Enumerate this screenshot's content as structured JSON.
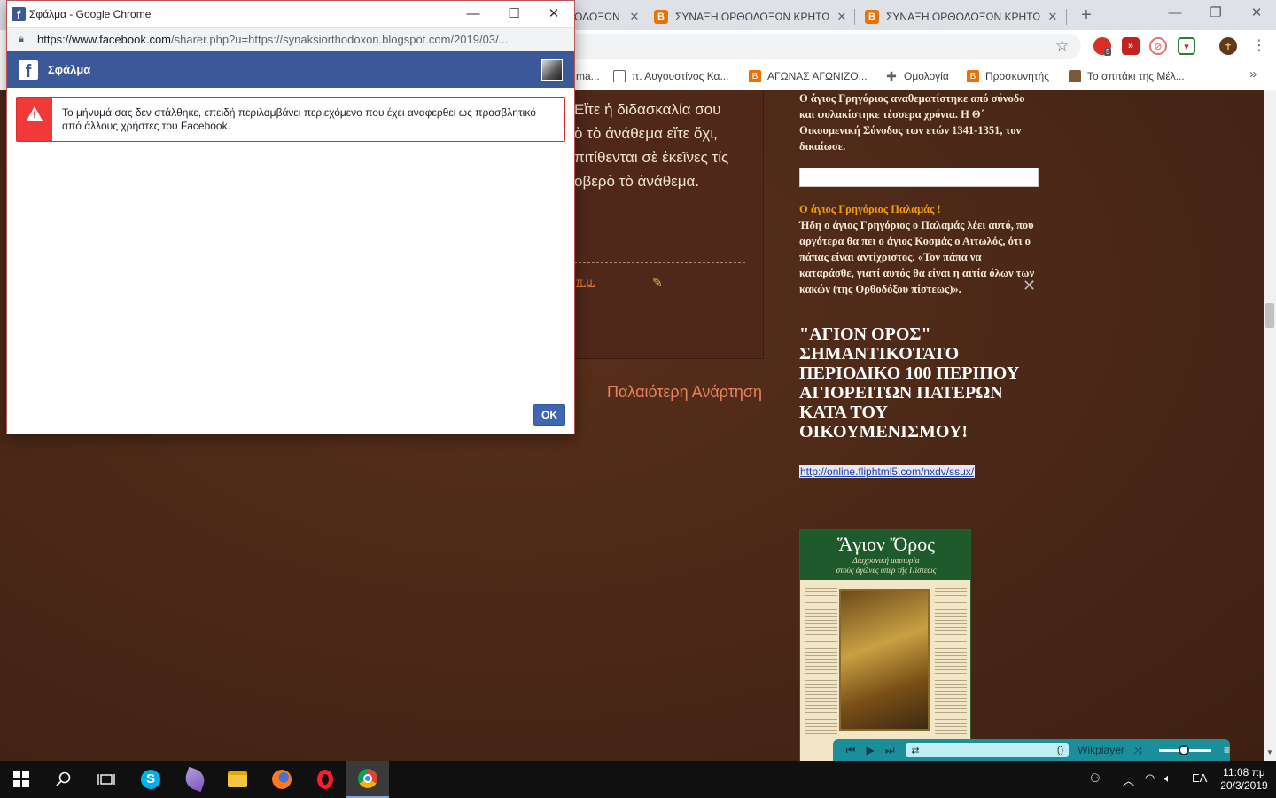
{
  "bg_window": {
    "tabs": [
      {
        "label": "ΟΔΟΞΩΝ"
      },
      {
        "label": "ΣΥΝΑΞΗ ΟΡΘΟΔΟΞΩΝ ΚΡΗΤΩΝ"
      },
      {
        "label": "ΣΥΝΑΞΗ ΟΡΘΟΔΟΞΩΝ ΚΡΗΤΩΝ"
      }
    ],
    "new_tab": "+",
    "bookmarks": [
      {
        "label": "ma..."
      },
      {
        "label": "π. Αυγουστίνος Κα..."
      },
      {
        "label": "ΑΓΩΝΑΣ ΑΓΩΝΙΖΟ..."
      },
      {
        "label": "Ομολογία"
      },
      {
        "label": "Προσκυνητής"
      },
      {
        "label": "Το σπιτάκι της Μέλ..."
      }
    ],
    "extensions_badge": "5"
  },
  "page": {
    "post_lines": [
      "Εἴτε ἡ διδασκαλία σου",
      "ὸ τὸ ἀνάθεμα εἴτε ὄχι,",
      "πιτίθενται σὲ ἐκεῖνες τίς",
      "οβερὸ τὸ ἀνάθεμα."
    ],
    "post_link_fragment": "π.μ.",
    "older_post": "Παλαιότερη Ανάρτηση",
    "sidebar_para1": "Ο άγιος Γρηγόριος αναθεματίστηκε από σύνοδο και φυλακίστηκε τέσσερα χρόνια.   Η Θ΄ Οικουμενική Σύνοδος των ετών 1341-1351, τον δικαίωσε.",
    "sidebar_heading2": "Ο άγιος Γρηγόριος Παλαμάς !",
    "sidebar_para2": "Ήδη ο άγιος Γρηγόριος ο Παλαμάς λέει αυτό, που αργότερα θα πει ο άγιος Κοσμάς ο Αιτωλός, ότι ο πάπας είναι αντίχριστος. «Τον πάπα να καταράσθε, γιατί αυτός θα είναι η αιτία όλων των κακών (της Ορθοδόξου πίστεως)».",
    "sidebar_big_heading": "\"ΑΓΙΟΝ ΟΡΟΣ\" ΣΗΜΑΝΤΙΚΟΤΑΤΟ ΠΕΡΙΟΔΙΚΟ 100 ΠΕΡΙΠΟΥ ΑΓΙΟΡΕΙΤΩΝ ΠΑΤΕΡΩΝ ΚΑΤΑ ΤΟΥ ΟΙΚΟΥΜΕΝΙΣΜΟΥ!",
    "sidebar_link": "http://online.fliphtml5.com/nxdv/ssux/",
    "book_title": "Ἅγιον Ὄρος",
    "book_subtitle_1": "Διαχρονική μαρτυρία",
    "book_subtitle_2": "στοὺς ἀγῶνες ὑπὲρ τῆς Πίστεως"
  },
  "wikplayer": {
    "name": "Wikplayer",
    "track_indicator": "()"
  },
  "popup": {
    "title": "Σφάλμα - Google Chrome",
    "url": "https://www.facebook.com/sharer.php?u=https://synaksiorthodoxon.blogspot.com/2019/03/...",
    "url_host": "https://www.facebook.com",
    "url_rest": "/sharer.php?u=https://synaksiorthodoxon.blogspot.com/2019/03/...",
    "header_title": "Σφάλμα",
    "error_message": "Το μήνυμά σας δεν στάλθηκε, επειδή περιλαμβάνει περιεχόμενο που έχει αναφερθεί ως προσβλητικό από άλλους χρήστες του Facebook.",
    "ok_label": "OK"
  },
  "taskbar": {
    "language": "ΕΛ",
    "time": "11:08 πμ",
    "date": "20/3/2019"
  }
}
